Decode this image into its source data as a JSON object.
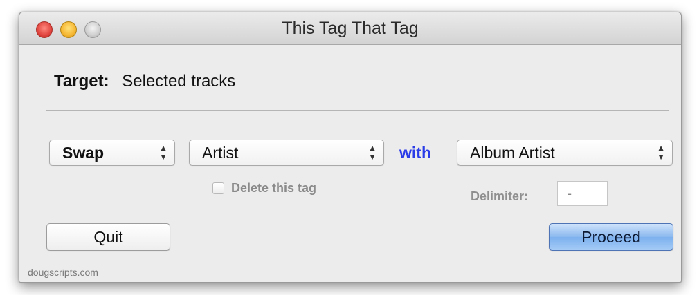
{
  "window": {
    "title": "This Tag That Tag"
  },
  "target": {
    "label": "Target:",
    "value": "Selected tracks"
  },
  "operation": {
    "selected": "Swap",
    "source_tag": "Artist",
    "connector": "with",
    "dest_tag": "Album Artist",
    "arrows_icon": "up-down-chevrons-icon"
  },
  "options": {
    "delete_tag_label": "Delete this tag",
    "delete_tag_checked": false,
    "delimiter_label": "Delimiter:",
    "delimiter_value": "-"
  },
  "buttons": {
    "quit": "Quit",
    "proceed": "Proceed"
  },
  "footer": {
    "credit": "dougscripts.com"
  },
  "colors": {
    "accent_with": "#2a3be8",
    "close": "#e0443e",
    "minimize": "#f5b632",
    "zoom_inactive": "#cfcfcf",
    "default_button": "#8ab8ef"
  }
}
